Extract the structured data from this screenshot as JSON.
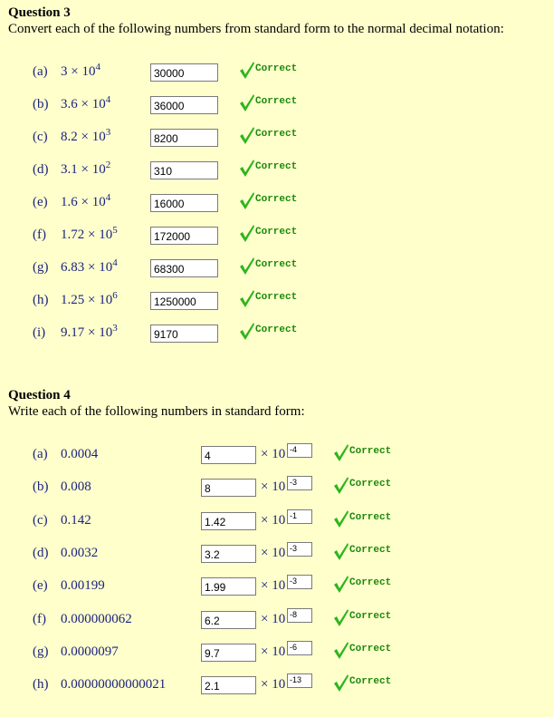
{
  "q3": {
    "title": "Question 3",
    "instruction": "Convert each of the following numbers from standard form to the normal decimal notation:",
    "items": [
      {
        "label": "(a)",
        "mant": "3 × 10",
        "exp": "4",
        "answer": "30000",
        "feedback": "Correct"
      },
      {
        "label": "(b)",
        "mant": "3.6 × 10",
        "exp": "4",
        "answer": "36000",
        "feedback": "Correct"
      },
      {
        "label": "(c)",
        "mant": "8.2 × 10",
        "exp": "3",
        "answer": "8200",
        "feedback": "Correct"
      },
      {
        "label": "(d)",
        "mant": "3.1 × 10",
        "exp": "2",
        "answer": "310",
        "feedback": "Correct"
      },
      {
        "label": "(e)",
        "mant": "1.6 × 10",
        "exp": "4",
        "answer": "16000",
        "feedback": "Correct"
      },
      {
        "label": "(f)",
        "mant": "1.72 × 10",
        "exp": "5",
        "answer": "172000",
        "feedback": "Correct"
      },
      {
        "label": "(g)",
        "mant": "6.83 × 10",
        "exp": "4",
        "answer": "68300",
        "feedback": "Correct"
      },
      {
        "label": "(h)",
        "mant": "1.25 × 10",
        "exp": "6",
        "answer": "1250000",
        "feedback": "Correct"
      },
      {
        "label": "(i)",
        "mant": "9.17 × 10",
        "exp": "3",
        "answer": "9170",
        "feedback": "Correct"
      }
    ]
  },
  "q4": {
    "title": "Question 4",
    "instruction": "Write each of the following numbers in standard form:",
    "times_text": "× 10",
    "items": [
      {
        "label": "(a)",
        "number": "0.0004",
        "mantissa": "4",
        "exponent": "-4",
        "feedback": "Correct"
      },
      {
        "label": "(b)",
        "number": "0.008",
        "mantissa": "8",
        "exponent": "-3",
        "feedback": "Correct"
      },
      {
        "label": "(c)",
        "number": "0.142",
        "mantissa": "1.42",
        "exponent": "-1",
        "feedback": "Correct"
      },
      {
        "label": "(d)",
        "number": "0.0032",
        "mantissa": "3.2",
        "exponent": "-3",
        "feedback": "Correct"
      },
      {
        "label": "(e)",
        "number": "0.00199",
        "mantissa": "1.99",
        "exponent": "-3",
        "feedback": "Correct"
      },
      {
        "label": "(f)",
        "number": "0.000000062",
        "mantissa": "6.2",
        "exponent": "-8",
        "feedback": "Correct"
      },
      {
        "label": "(g)",
        "number": "0.0000097",
        "mantissa": "9.7",
        "exponent": "-6",
        "feedback": "Correct"
      },
      {
        "label": "(h)",
        "number": "0.00000000000021",
        "mantissa": "2.1",
        "exponent": "-13",
        "feedback": "Correct"
      }
    ]
  },
  "colors": {
    "background": "#FFFFCC",
    "item_text": "#1A237E",
    "feedback_green": "#1B8A0A",
    "check_green": "#2DB51D"
  },
  "icons": {
    "feedback": "check-mark-icon"
  }
}
